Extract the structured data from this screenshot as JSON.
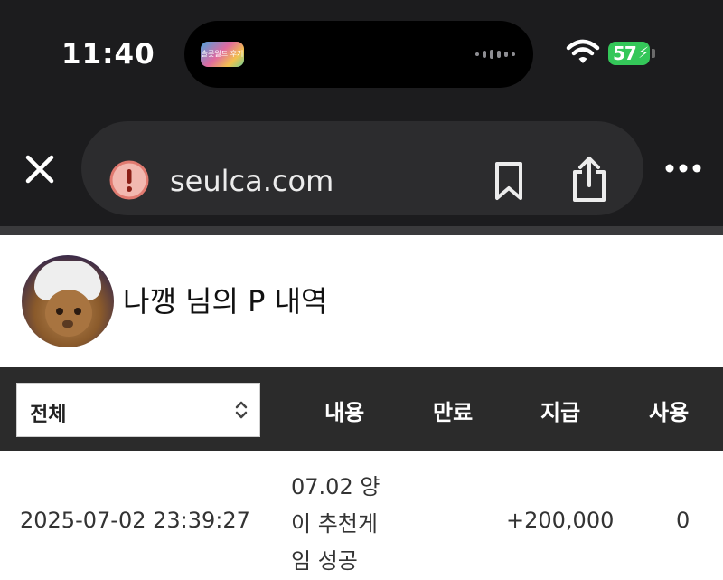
{
  "status_bar": {
    "time": "11:40",
    "island_thumb_text": "슬롯월드 후기",
    "battery_level": "57",
    "icons": [
      "wifi-icon",
      "battery-charging-icon"
    ]
  },
  "browser": {
    "url": "seulca.com",
    "icons": [
      "close-icon",
      "warning-icon",
      "bookmark-icon",
      "share-icon",
      "more-icon"
    ]
  },
  "page": {
    "title": "나깽 님의 P 내역"
  },
  "table": {
    "filter": {
      "selected": "전체"
    },
    "headers": {
      "content": "내용",
      "expiry": "만료",
      "issued": "지급",
      "used": "사용"
    },
    "rows": [
      {
        "date": "2025-07-02 23:39:27",
        "desc_lines": [
          "07.02 양",
          "이 추천게",
          "임 성공"
        ],
        "expiry": "",
        "issued": "+200,000",
        "used": "0"
      }
    ]
  },
  "colors": {
    "chrome_bg": "#1c1c1e",
    "url_bar_bg": "#2c2c2e",
    "table_header_bg": "#2b2b2b",
    "battery_green": "#34c759",
    "warning_red": "#f08a80"
  }
}
